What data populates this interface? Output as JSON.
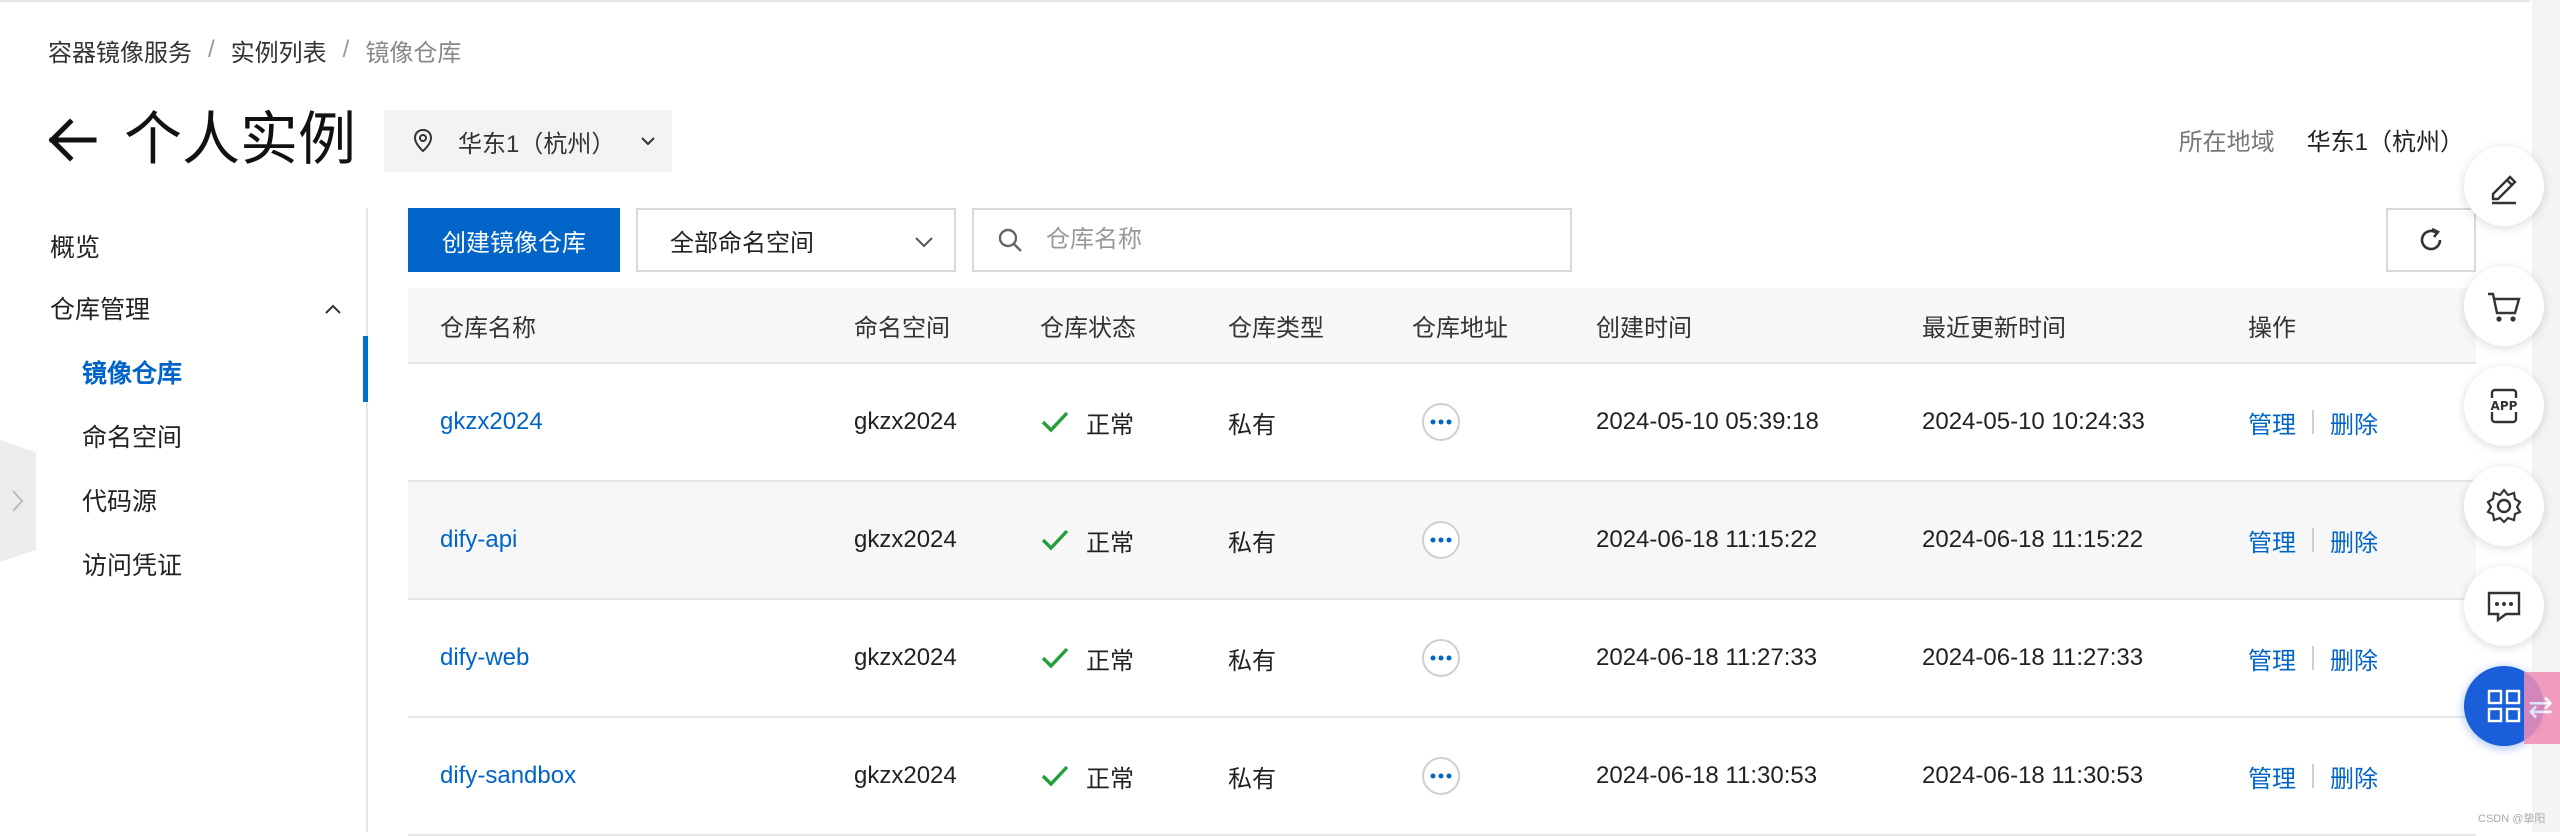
{
  "breadcrumb": {
    "items": [
      "容器镜像服务",
      "实例列表",
      "镜像仓库"
    ],
    "separator": "/"
  },
  "header": {
    "title": "个人实例",
    "region_select": "华东1（杭州）",
    "region_label": "所在地域",
    "region_value": "华东1（杭州）"
  },
  "sidebar": {
    "overview": "概览",
    "repo_management": "仓库管理",
    "sub_items": [
      {
        "label": "镜像仓库",
        "active": true
      },
      {
        "label": "命名空间",
        "active": false
      },
      {
        "label": "代码源",
        "active": false
      },
      {
        "label": "访问凭证",
        "active": false
      }
    ]
  },
  "toolbar": {
    "create_button": "创建镜像仓库",
    "namespace_filter": "全部命名空间",
    "search_placeholder": "仓库名称"
  },
  "table": {
    "headers": [
      "仓库名称",
      "命名空间",
      "仓库状态",
      "仓库类型",
      "仓库地址",
      "创建时间",
      "最近更新时间",
      "操作"
    ],
    "rows": [
      {
        "name": "gkzx2024",
        "namespace": "gkzx2024",
        "status": "正常",
        "type": "私有",
        "created": "2024-05-10 05:39:18",
        "updated": "2024-05-10 10:24:33",
        "op_manage": "管理",
        "op_delete": "删除"
      },
      {
        "name": "dify-api",
        "namespace": "gkzx2024",
        "status": "正常",
        "type": "私有",
        "created": "2024-06-18 11:15:22",
        "updated": "2024-06-18 11:15:22",
        "op_manage": "管理",
        "op_delete": "删除"
      },
      {
        "name": "dify-web",
        "namespace": "gkzx2024",
        "status": "正常",
        "type": "私有",
        "created": "2024-06-18 11:27:33",
        "updated": "2024-06-18 11:27:33",
        "op_manage": "管理",
        "op_delete": "删除"
      },
      {
        "name": "dify-sandbox",
        "namespace": "gkzx2024",
        "status": "正常",
        "type": "私有",
        "created": "2024-06-18 11:30:53",
        "updated": "2024-06-18 11:30:53",
        "op_manage": "管理",
        "op_delete": "删除"
      }
    ]
  },
  "float_tools": [
    "edit-icon",
    "cart-icon",
    "app-icon",
    "settings-icon",
    "chat-icon",
    "apps-grid-icon"
  ],
  "float_labels": {
    "app": "APP"
  },
  "watermark": "CSDN @挚阳",
  "colors": {
    "primary": "#0064c8",
    "success": "#23a03c",
    "float_blue": "#1a5fd9"
  }
}
